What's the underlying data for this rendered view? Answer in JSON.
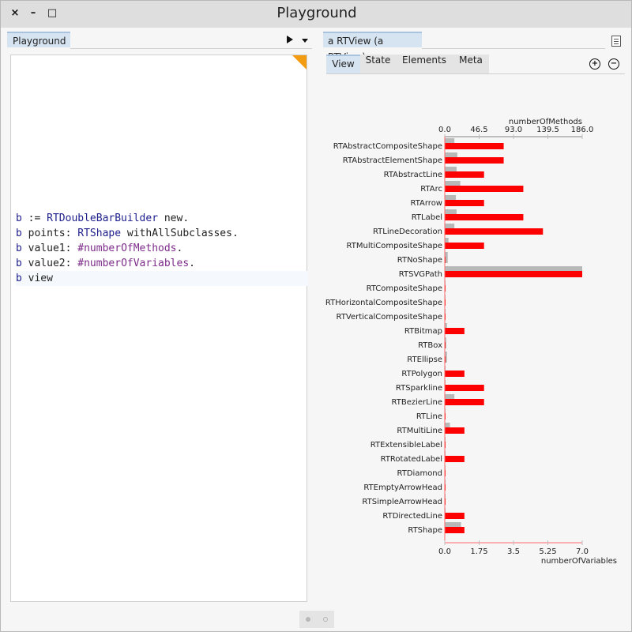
{
  "window": {
    "title": "Playground",
    "close_label": "×",
    "minimize_label": "–",
    "maximize_label": "□"
  },
  "left_pane": {
    "tab_label": "Playground",
    "code_lines": [
      {
        "segments": [
          {
            "t": "b",
            "c": "kw"
          },
          {
            "t": " := ",
            "c": ""
          },
          {
            "t": "RTDoubleBarBuilder",
            "c": "cls"
          },
          {
            "t": " new.",
            "c": ""
          }
        ]
      },
      {
        "segments": [
          {
            "t": "b",
            "c": "kw"
          },
          {
            "t": " points: ",
            "c": ""
          },
          {
            "t": "RTShape",
            "c": "cls"
          },
          {
            "t": " withAllSubclasses.",
            "c": ""
          }
        ]
      },
      {
        "segments": [
          {
            "t": "b",
            "c": "kw"
          },
          {
            "t": " value1: ",
            "c": ""
          },
          {
            "t": "#numberOfMethods",
            "c": "sym"
          },
          {
            "t": ".",
            "c": ""
          }
        ]
      },
      {
        "segments": [
          {
            "t": "b",
            "c": "kw"
          },
          {
            "t": " value2: ",
            "c": ""
          },
          {
            "t": "#numberOfVariables",
            "c": "sym"
          },
          {
            "t": ".",
            "c": ""
          }
        ]
      },
      {
        "segments": [
          {
            "t": "b",
            "c": "kw"
          },
          {
            "t": " view",
            "c": ""
          }
        ]
      }
    ]
  },
  "right_pane": {
    "tab_label": "a RTView (a RTView)",
    "inspector_tabs": [
      "View",
      "State",
      "Elements",
      "Meta"
    ],
    "active_tab": "View",
    "zoom_in_label": "+",
    "zoom_out_label": "−"
  },
  "chart_data": {
    "type": "bar",
    "orientation": "horizontal",
    "categories": [
      "RTAbstractCompositeShape",
      "RTAbstractElementShape",
      "RTAbstractLine",
      "RTArc",
      "RTArrow",
      "RTLabel",
      "RTLineDecoration",
      "RTMultiCompositeShape",
      "RTNoShape",
      "RTSVGPath",
      "RTCompositeShape",
      "RTHorizontalCompositeShape",
      "RTVerticalCompositeShape",
      "RTBitmap",
      "RTBox",
      "RTEllipse",
      "RTPolygon",
      "RTSparkline",
      "RTBezierLine",
      "RTLine",
      "RTMultiLine",
      "RTExtensibleLabel",
      "RTRotatedLabel",
      "RTDiamond",
      "RTEmptyArrowHead",
      "RTSimpleArrowHead",
      "RTDirectedLine",
      "RTShape"
    ],
    "series": [
      {
        "name": "numberOfMethods",
        "color": "#b8b8b8",
        "axis": "top",
        "values": [
          13,
          17,
          16,
          21,
          15,
          16,
          13,
          5,
          4,
          186,
          1,
          1,
          1,
          3,
          2,
          3,
          1,
          1,
          13,
          1,
          7,
          0,
          1,
          0,
          0,
          0,
          1,
          22
        ]
      },
      {
        "name": "numberOfVariables",
        "color": "#ff0000",
        "axis": "bottom",
        "values": [
          3,
          3,
          2,
          4,
          2,
          4,
          5,
          2,
          0,
          7,
          0,
          0,
          0,
          1,
          0,
          0,
          1,
          2,
          2,
          0,
          1,
          0,
          1,
          0,
          0,
          0,
          1,
          1
        ]
      }
    ],
    "top_axis": {
      "label": "numberOfMethods",
      "ticks": [
        "0.0",
        "46.5",
        "93.0",
        "139.5",
        "186.0"
      ],
      "range": [
        0,
        186
      ]
    },
    "bottom_axis": {
      "label": "numberOfVariables",
      "ticks": [
        "0.0",
        "1.75",
        "3.5",
        "5.25",
        "7.0"
      ],
      "range": [
        0,
        7
      ]
    }
  },
  "pager": {
    "pages": 2,
    "current": 1
  }
}
